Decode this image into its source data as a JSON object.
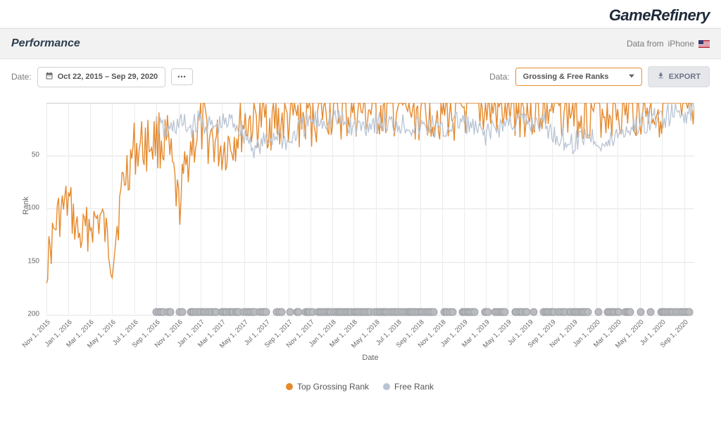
{
  "brand": "GameRefinery",
  "header": {
    "title": "Performance",
    "source_prefix": "Data from",
    "source_device": "iPhone",
    "country": "US"
  },
  "toolbar": {
    "date_label": "Date:",
    "date_range": "Oct 22, 2015   –   Sep 29, 2020",
    "more_dots": "•••",
    "data_label": "Data:",
    "data_select_value": "Grossing & Free Ranks",
    "export_label": "EXPORT"
  },
  "chart_data": {
    "type": "line",
    "title": "",
    "xlabel": "Date",
    "ylabel": "Rank",
    "ylim": [
      1,
      200
    ],
    "y_ticks": [
      50,
      100,
      150,
      200
    ],
    "x_ticks": [
      "Nov 1, 2015",
      "Jan 1, 2016",
      "Mar 1, 2016",
      "May 1, 2016",
      "Jul 1, 2016",
      "Sep 1, 2016",
      "Nov 1, 2016",
      "Jan 1, 2017",
      "Mar 1, 2017",
      "May 1, 2017",
      "Jul 1, 2017",
      "Sep 1, 2017",
      "Nov 1, 2017",
      "Jan 1, 2018",
      "Mar 1, 2018",
      "May 1, 2018",
      "Jul 1, 2018",
      "Sep 1, 2018",
      "Nov 1, 2018",
      "Jan 1, 2019",
      "Mar 1, 2019",
      "May 1, 2019",
      "Jul 1, 2019",
      "Sep 1, 2019",
      "Nov 1, 2019",
      "Jan 1, 2020",
      "Mar 1, 2020",
      "May 1, 2020",
      "Jul 1, 2020",
      "Sep 1, 2020"
    ],
    "legend": [
      {
        "name": "Top Grossing Rank",
        "color": "#e58a2e"
      },
      {
        "name": "Free Rank",
        "color": "#b9c4d3"
      }
    ],
    "series": [
      {
        "name": "Top Grossing Rank",
        "color": "#e58a2e",
        "x": [
          "Nov 1, 2015",
          "Dec 1, 2015",
          "Jan 1, 2016",
          "Feb 1, 2016",
          "Mar 1, 2016",
          "Apr 1, 2016",
          "May 1, 2016",
          "Jun 1, 2016",
          "Jul 1, 2016",
          "Aug 1, 2016",
          "Sep 1, 2016",
          "Oct 1, 2016",
          "Nov 1, 2016",
          "Dec 1, 2016",
          "Jan 1, 2017",
          "Feb 1, 2017",
          "Mar 1, 2017",
          "Apr 1, 2017",
          "May 1, 2017",
          "Jun 1, 2017",
          "Jul 1, 2017",
          "Aug 1, 2017",
          "Sep 1, 2017",
          "Oct 1, 2017",
          "Nov 1, 2017",
          "Dec 1, 2017",
          "Jan 1, 2018",
          "Feb 1, 2018",
          "Mar 1, 2018",
          "Apr 1, 2018",
          "May 1, 2018",
          "Jun 1, 2018",
          "Jul 1, 2018",
          "Aug 1, 2018",
          "Sep 1, 2018",
          "Oct 1, 2018",
          "Nov 1, 2018",
          "Dec 1, 2018",
          "Jan 1, 2019",
          "Feb 1, 2019",
          "Mar 1, 2019",
          "Apr 1, 2019",
          "May 1, 2019",
          "Jun 1, 2019",
          "Jul 1, 2019",
          "Aug 1, 2019",
          "Sep 1, 2019",
          "Oct 1, 2019",
          "Nov 1, 2019",
          "Dec 1, 2019",
          "Jan 1, 2020",
          "Feb 1, 2020",
          "Mar 1, 2020",
          "Apr 1, 2020",
          "May 1, 2020",
          "Jun 1, 2020",
          "Jul 1, 2020",
          "Aug 1, 2020",
          "Sep 1, 2020",
          "Sep 29, 2020"
        ],
        "values": [
          155,
          110,
          95,
          130,
          115,
          110,
          150,
          75,
          45,
          40,
          35,
          40,
          100,
          45,
          25,
          35,
          45,
          35,
          20,
          18,
          16,
          20,
          18,
          15,
          15,
          6,
          8,
          12,
          8,
          10,
          8,
          10,
          6,
          8,
          10,
          6,
          8,
          10,
          6,
          7,
          6,
          8,
          6,
          5,
          6,
          7,
          6,
          5,
          6,
          7,
          5,
          6,
          5,
          6,
          5,
          5,
          4,
          5,
          4,
          4
        ]
      },
      {
        "name": "Free Rank",
        "color": "#b9c4d3",
        "x": [
          "Sep 1, 2016",
          "Oct 1, 2016",
          "Nov 1, 2016",
          "Dec 1, 2016",
          "Jan 1, 2017",
          "Feb 1, 2017",
          "Mar 1, 2017",
          "Apr 1, 2017",
          "May 1, 2017",
          "Jun 1, 2017",
          "Jul 1, 2017",
          "Aug 1, 2017",
          "Sep 1, 2017",
          "Oct 1, 2017",
          "Nov 1, 2017",
          "Dec 1, 2017",
          "Jan 1, 2018",
          "Feb 1, 2018",
          "Mar 1, 2018",
          "Apr 1, 2018",
          "May 1, 2018",
          "Jun 1, 2018",
          "Jul 1, 2018",
          "Aug 1, 2018",
          "Sep 1, 2018",
          "Oct 1, 2018",
          "Nov 1, 2018",
          "Dec 1, 2018",
          "Jan 1, 2019",
          "Feb 1, 2019",
          "Mar 1, 2019",
          "Apr 1, 2019",
          "May 1, 2019",
          "Jun 1, 2019",
          "Jul 1, 2019",
          "Aug 1, 2019",
          "Sep 1, 2019",
          "Oct 1, 2019",
          "Nov 1, 2019",
          "Dec 1, 2019",
          "Jan 1, 2020",
          "Feb 1, 2020",
          "Mar 1, 2020",
          "Apr 1, 2020",
          "May 1, 2020",
          "Jun 1, 2020",
          "Jul 1, 2020",
          "Aug 1, 2020",
          "Sep 1, 2020",
          "Sep 29, 2020"
        ],
        "values": [
          22,
          30,
          20,
          25,
          18,
          25,
          22,
          18,
          30,
          45,
          38,
          30,
          40,
          25,
          20,
          18,
          15,
          20,
          25,
          22,
          18,
          22,
          20,
          22,
          25,
          22,
          30,
          20,
          18,
          28,
          30,
          25,
          20,
          18,
          22,
          18,
          30,
          35,
          40,
          30,
          35,
          42,
          30,
          25,
          22,
          18,
          15,
          12,
          10,
          8
        ]
      }
    ],
    "event_markers_start": "Sep 1, 2016"
  }
}
